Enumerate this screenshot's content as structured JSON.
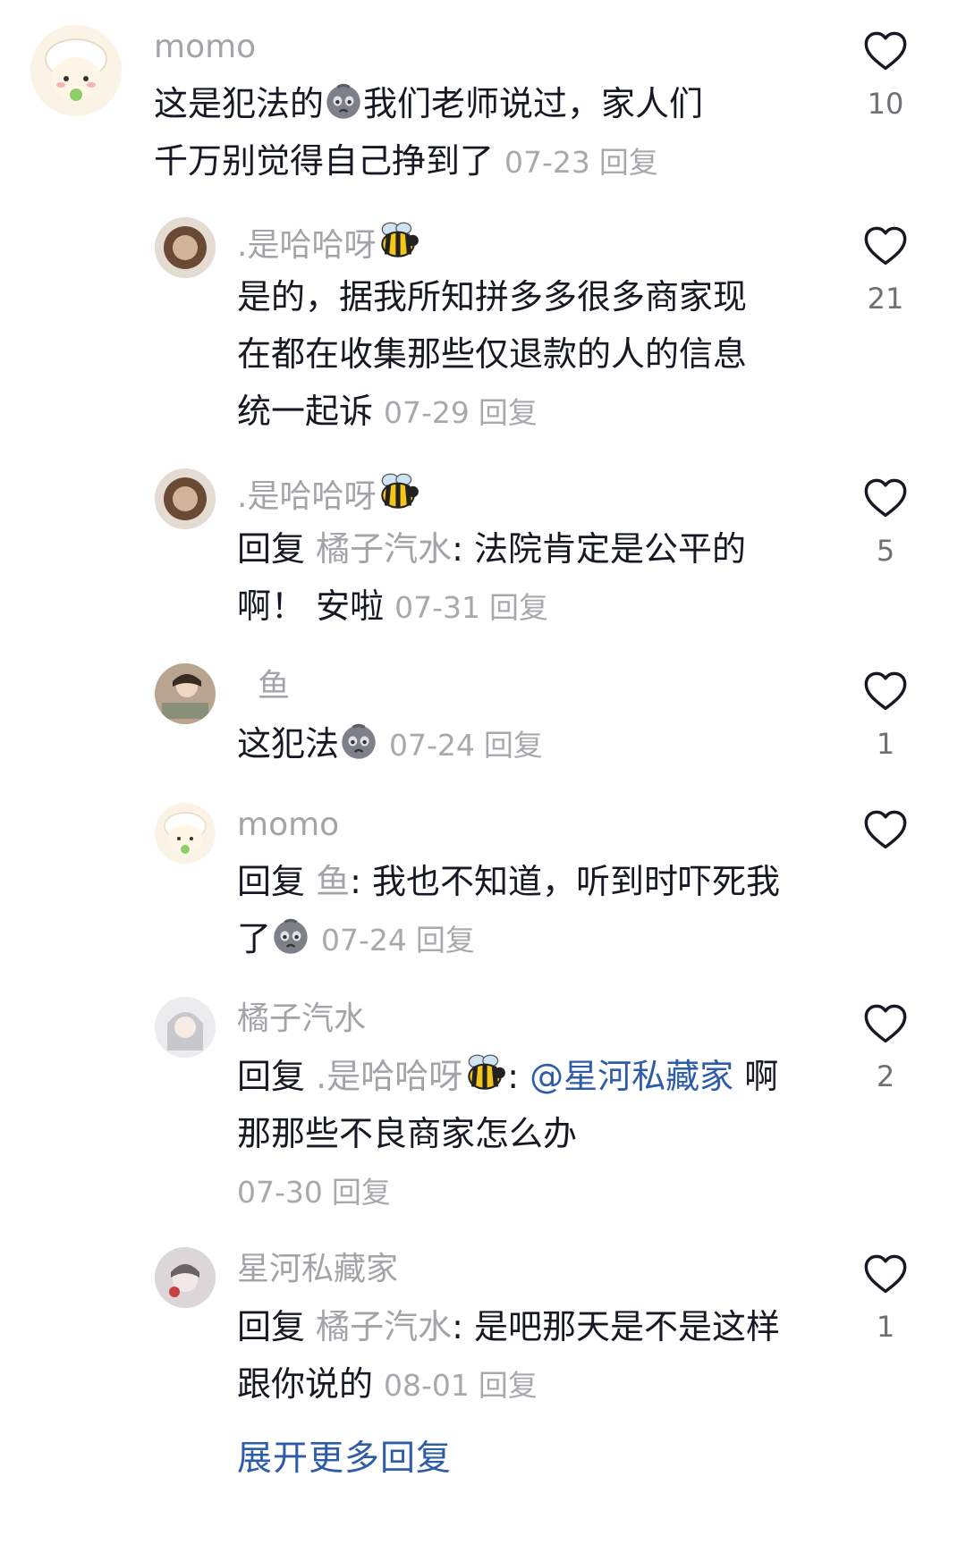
{
  "comments": [
    {
      "user": "momo",
      "text": "这是犯法的",
      "text2": "我们老师说过，家人们千万别觉得自己挣到了",
      "date": "07-23",
      "reply": "回复",
      "likes": "10"
    },
    {
      "user": ".是哈哈呀",
      "text": "是的，据我所知拼多多很多商家现在都在收集那些仅退款的人的信息统一起诉",
      "date": "07-29",
      "reply": "回复",
      "likes": "21"
    },
    {
      "user": ".是哈哈呀",
      "prefix": "回复",
      "target": "橘子汽水",
      "text": ": 法院肯定是公平的啊！ 安啦",
      "date": "07-31",
      "reply": "回复",
      "likes": "5"
    },
    {
      "user": "鱼",
      "text": "这犯法",
      "date": "07-24",
      "reply": "回复",
      "likes": "1"
    },
    {
      "user": "momo",
      "prefix": "回复",
      "target": "鱼",
      "text": ": 我也不知道，听到时吓死我了",
      "date": "07-24",
      "reply": "回复",
      "likes": ""
    },
    {
      "user": "橘子汽水",
      "prefix": "回复",
      "target": ".是哈哈呀",
      "colon": ":",
      "mention": "@星河私藏家",
      "text": "啊 那那些不良商家怎么办",
      "date": "07-30",
      "reply": "回复",
      "likes": "2"
    },
    {
      "user": "星河私藏家",
      "prefix": "回复",
      "target": "橘子汽水",
      "text": ": 是吧那天是不是这样跟你说的",
      "date": "08-01",
      "reply": "回复",
      "likes": "1"
    }
  ],
  "expand_more": "展开更多回复",
  "icons": {
    "like": "heart-outline-icon",
    "emoji_sad": "sad-face-emoji",
    "emoji_bee": "bee-emoji"
  },
  "colors": {
    "link": "#2e5ca8",
    "muted": "#a3a4a8",
    "text": "#161823"
  }
}
